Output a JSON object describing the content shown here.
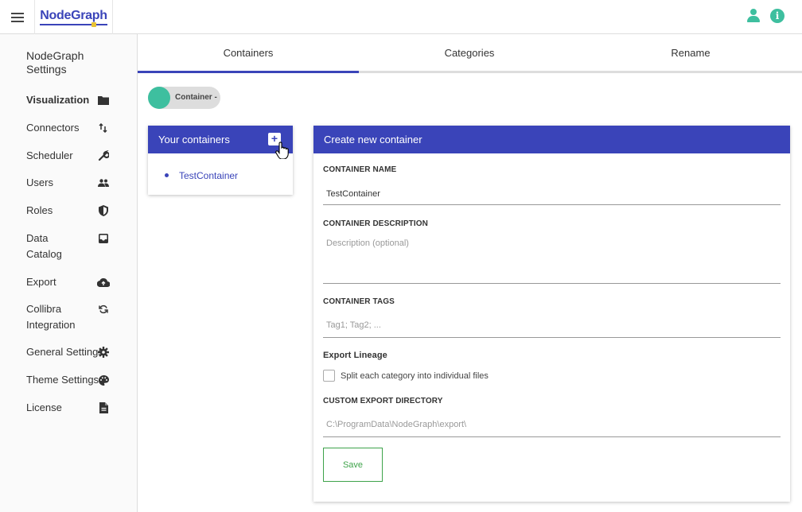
{
  "app": {
    "logo_text": "NodeGraph"
  },
  "sidebar": {
    "title": "NodeGraph Settings",
    "items": [
      {
        "label": "Visualization",
        "icon": "folder-icon",
        "active": true
      },
      {
        "label": "Connectors",
        "icon": "swap-vertical-icon"
      },
      {
        "label": "Scheduler",
        "icon": "wrench-icon"
      },
      {
        "label": "Users",
        "icon": "users-icon"
      },
      {
        "label": "Roles",
        "icon": "shield-icon"
      },
      {
        "label": "Data Catalog",
        "icon": "inbox-icon"
      },
      {
        "label": "Export",
        "icon": "cloud-upload-icon"
      },
      {
        "label": "Collibra Integration",
        "icon": "sync-icon"
      },
      {
        "label": "General Settings",
        "icon": "gear-icon"
      },
      {
        "label": "Theme Settings",
        "icon": "palette-icon"
      },
      {
        "label": "License",
        "icon": "document-icon"
      }
    ]
  },
  "tabs": [
    {
      "label": "Containers",
      "active": true
    },
    {
      "label": "Categories"
    },
    {
      "label": "Rename"
    }
  ],
  "toggle": {
    "label": "Container -"
  },
  "containers_panel": {
    "title": "Your containers",
    "add_label": "+",
    "items": [
      "TestContainer"
    ]
  },
  "create_panel": {
    "title": "Create new container",
    "name_label": "CONTAINER NAME",
    "name_value": "TestContainer",
    "description_label": "CONTAINER DESCRIPTION",
    "description_placeholder": "Description (optional)",
    "tags_label": "CONTAINER TAGS",
    "tags_placeholder": "Tag1; Tag2; ...",
    "export_lineage_label": "Export Lineage",
    "split_label": "Split each category into individual files",
    "export_dir_label": "CUSTOM EXPORT DIRECTORY",
    "export_dir_placeholder": "C:\\ProgramData\\NodeGraph\\export\\",
    "save_label": "Save"
  },
  "colors": {
    "primary": "#3a44b9",
    "accent": "#3ebf9f",
    "save": "#3ea34a"
  }
}
